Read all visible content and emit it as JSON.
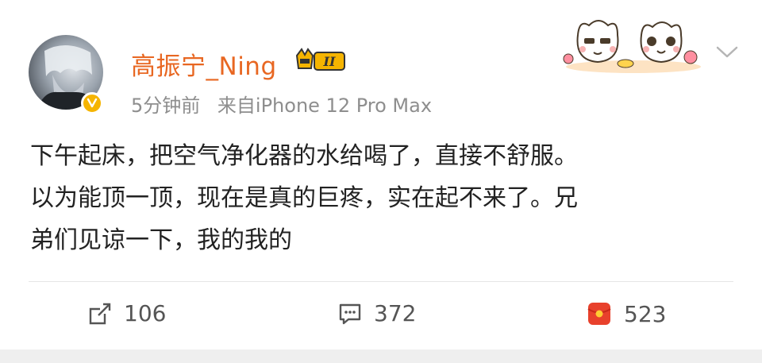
{
  "post": {
    "username": "高振宁_Ning",
    "vip_level": "II",
    "time": "5分钟前",
    "source": "来自iPhone 12 Pro Max",
    "text_lines": [
      "下午起床，把空气净化器的水给喝了，直接不舒服。",
      "以为能顶一顶，现在是真的巨疼，实在起不来了。兄",
      "弟们见谅一下，我的我的"
    ]
  },
  "actions": {
    "repost_count": "106",
    "comment_count": "372",
    "like_count": "523"
  },
  "colors": {
    "username": "#e86722",
    "meta": "#8e8e8e",
    "verified": "#f5b400",
    "like_icon": "#e8412c"
  },
  "icons": {
    "verified": "verified-badge-icon",
    "vip": "vip-crown-icon",
    "more": "chevron-down-icon",
    "repost": "repost-icon",
    "comment": "comment-icon",
    "like": "red-packet-like-icon"
  }
}
